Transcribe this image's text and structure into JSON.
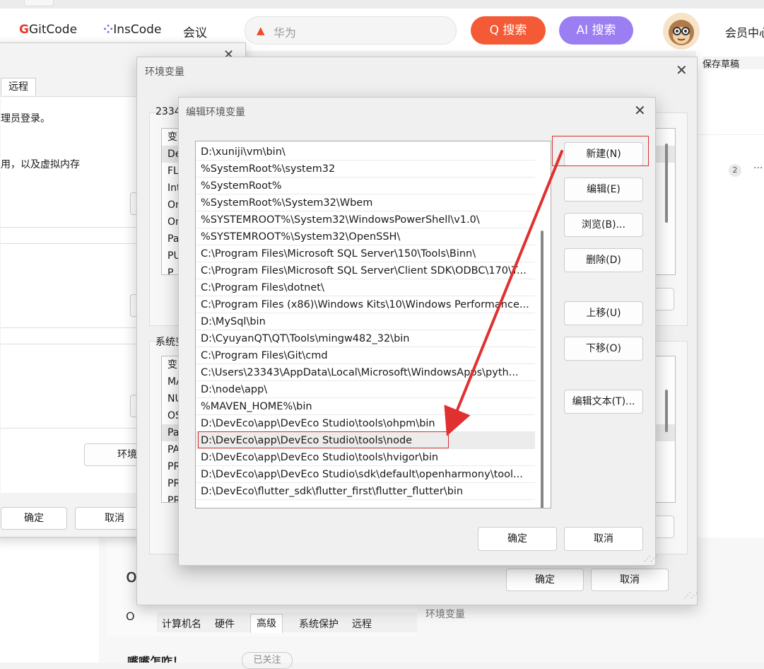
{
  "browser": {
    "nav": {
      "gitcode_mark": "G",
      "gitcode_label": "GitCode",
      "inscode_mark": "⁘",
      "inscode_label": "InsCode",
      "meeting_label": "会议"
    },
    "search": {
      "placeholder": "华为",
      "search_button": "Q 搜索",
      "ai_search_button": "AI 搜索"
    },
    "member_label": "会员中心",
    "draft_label": "保存草稿",
    "comment_count": "2",
    "more_glyph": "···"
  },
  "system_properties": {
    "active_tab": "远程",
    "admin_text": "理员登录。",
    "memory_text": "用，以及虚拟内存",
    "env_button": "环境",
    "ok_label": "确定",
    "cancel_label": "取消"
  },
  "env_dialog": {
    "title": "环境变量",
    "user_group_label": "2334",
    "user_vars_visible": [
      "变",
      "De",
      "FLI",
      "Int",
      "On",
      "On",
      "Pa",
      "PU",
      "P"
    ],
    "system_group_label": "系统变",
    "system_vars_visible": [
      "变",
      "MA",
      "NU",
      "OS",
      "Pa",
      "PA",
      "PR",
      "PR",
      "PR"
    ],
    "ok_label": "确定",
    "cancel_label": "取消"
  },
  "edit_dialog": {
    "title": "编辑环境变量",
    "entries": [
      "D:\\xuniji\\vm\\bin\\",
      "%SystemRoot%\\system32",
      "%SystemRoot%",
      "%SystemRoot%\\System32\\Wbem",
      "%SYSTEMROOT%\\System32\\WindowsPowerShell\\v1.0\\",
      "%SYSTEMROOT%\\System32\\OpenSSH\\",
      "C:\\Program Files\\Microsoft SQL Server\\150\\Tools\\Binn\\",
      "C:\\Program Files\\Microsoft SQL Server\\Client SDK\\ODBC\\170\\T...",
      "C:\\Program Files\\dotnet\\",
      "C:\\Program Files (x86)\\Windows Kits\\10\\Windows Performance...",
      "D:\\MySql\\bin",
      "D:\\CyuyanQT\\QT\\Tools\\mingw482_32\\bin",
      "C:\\Program Files\\Git\\cmd",
      "C:\\Users\\23343\\AppData\\Local\\Microsoft\\WindowsApps\\pyth...",
      "D:\\node\\app\\",
      "%MAVEN_HOME%\\bin",
      "D:\\DevEco\\app\\DevEco Studio\\tools\\ohpm\\bin",
      "D:\\DevEco\\app\\DevEco Studio\\tools\\node",
      "D:\\DevEco\\app\\DevEco Studio\\tools\\hvigor\\bin",
      "D:\\DevEco\\app\\DevEco Studio\\sdk\\default\\openharmony\\tool...",
      "D:\\DevEco\\flutter_sdk\\flutter_first\\flutter_flutter\\bin"
    ],
    "highlighted_entry": "D:\\DevEco\\app\\DevEco Studio\\tools\\node",
    "buttons": {
      "new": "新建(N)",
      "edit": "编辑(E)",
      "browse": "浏览(B)...",
      "delete": "删除(D)",
      "move_up": "上移(U)",
      "move_down": "下移(O)",
      "edit_text": "编辑文本(T)..."
    },
    "ok_label": "确定",
    "cancel_label": "取消"
  },
  "background_page": {
    "tabs": [
      "计算机名",
      "硬件",
      "高级",
      "系统保护",
      "远程"
    ],
    "selected_tab": "高级",
    "env_section_label": "环境变量",
    "left_glyph": "O",
    "partial_heading": "or",
    "author_name": "嘴嘴怎咋！",
    "follow_label": "已关注"
  },
  "colors": {
    "search_button": "#f45a35",
    "ai_button": "#9b7ef2",
    "annotation_red": "#d83232",
    "gitcode_red": "#e8382a",
    "inscode_purple": "#6b5bf0"
  }
}
